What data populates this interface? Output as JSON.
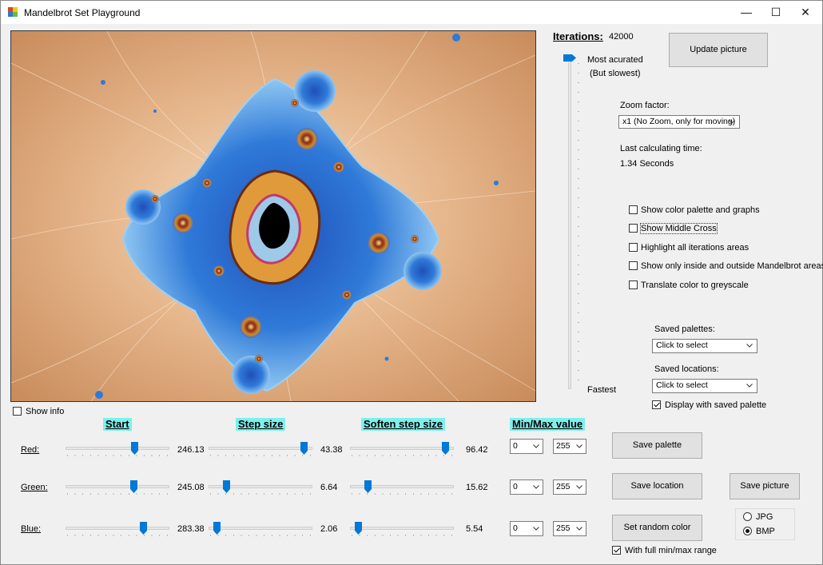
{
  "window": {
    "title": "Mandelbrot Set Playground",
    "controls": {
      "minimize": "—",
      "maximize": "☐",
      "close": "✕"
    }
  },
  "iterations": {
    "label": "Iterations:",
    "value": "42000",
    "slider_top_label": "Most acurated",
    "slider_top_sublabel": "(But slowest)",
    "slider_bottom_label": "Fastest"
  },
  "update_button": "Update picture",
  "zoom": {
    "label": "Zoom factor:",
    "selected": "x1 (No Zoom, only for moving)"
  },
  "last_calc": {
    "label": "Last calculating time:",
    "value": "1.34 Seconds"
  },
  "options": [
    {
      "label": "Show color palette and graphs",
      "checked": false
    },
    {
      "label": "Show Middle Cross",
      "checked": false
    },
    {
      "label": "Highlight all iterations areas",
      "checked": false
    },
    {
      "label": "Show only inside and outside Mandelbrot areas",
      "checked": false
    },
    {
      "label": "Translate color to greyscale",
      "checked": false
    }
  ],
  "saved_palettes": {
    "label": "Saved palettes:",
    "selected": "Click to select"
  },
  "saved_locations": {
    "label": "Saved locations:",
    "selected": "Click to select"
  },
  "display_saved_palette": {
    "label": "Display with saved palette",
    "checked": true
  },
  "show_info": {
    "label": "Show info",
    "checked": false
  },
  "headers": {
    "start": "Start",
    "step": "Step size",
    "soften": "Soften step size",
    "minmax": "Min/Max value"
  },
  "rows": [
    {
      "label": "Red:",
      "start": "246.13",
      "step": "43.38",
      "soften": "96.42",
      "start_pos": 0.68,
      "step_pos": 0.95,
      "soften_pos": 0.95,
      "min": "0",
      "max": "255"
    },
    {
      "label": "Green:",
      "start": "245.08",
      "step": "6.64",
      "soften": "15.62",
      "start_pos": 0.67,
      "step_pos": 0.15,
      "soften_pos": 0.15,
      "min": "0",
      "max": "255"
    },
    {
      "label": "Blue:",
      "start": "283.38",
      "step": "2.06",
      "soften": "5.54",
      "start_pos": 0.77,
      "step_pos": 0.05,
      "soften_pos": 0.05,
      "min": "0",
      "max": "255"
    }
  ],
  "buttons": {
    "save_palette": "Save  palette",
    "save_location": "Save location",
    "save_picture": "Save picture",
    "set_random_color": "Set random color"
  },
  "full_range": {
    "label": "With full min/max range",
    "checked": true
  },
  "format": {
    "options": [
      "JPG",
      "BMP"
    ],
    "selected": "BMP"
  },
  "colors": {
    "accent": "#0078d7",
    "header_bg": "#7df0ec",
    "fractal_bg": "#d7a47a",
    "fractal_blue": "#2a6fd1"
  }
}
